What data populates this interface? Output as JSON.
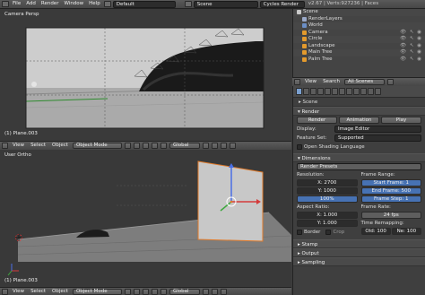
{
  "topbar": {
    "menus": [
      "File",
      "Add",
      "Render",
      "Window",
      "Help"
    ],
    "layout": "Default",
    "scene": "Scene",
    "engine": "Cycles Render",
    "stats": "v2.67 | Verts:927236 | Faces"
  },
  "viewport_top": {
    "label": "Camera Persp",
    "object": "(1) Plane.003",
    "header": {
      "menus": [
        "View",
        "Select",
        "Object"
      ],
      "mode": "Object Mode",
      "orientation": "Global"
    }
  },
  "viewport_bottom": {
    "label": "User Ortho",
    "object": "(1) Plane.003",
    "header": {
      "menus": [
        "View",
        "Select",
        "Object"
      ],
      "mode": "Object Mode",
      "orientation": "Global"
    }
  },
  "outliner": {
    "rows": [
      {
        "label": "Scene",
        "color": "#c9c9c9",
        "indent": 0
      },
      {
        "label": "RenderLayers",
        "color": "#9aa9c8",
        "indent": 1
      },
      {
        "label": "World",
        "color": "#6b8fc7",
        "indent": 1
      },
      {
        "label": "Camera",
        "color": "#e39a2d",
        "indent": 1
      },
      {
        "label": "Circle",
        "color": "#e39a2d",
        "indent": 1
      },
      {
        "label": "Landscape",
        "color": "#e39a2d",
        "indent": 1
      },
      {
        "label": "Main Tree",
        "color": "#e39a2d",
        "indent": 1
      },
      {
        "label": "Palm Tree",
        "color": "#e39a2d",
        "indent": 1
      }
    ],
    "header": {
      "menus": [
        "View",
        "Search"
      ],
      "filter": "All Scenes"
    }
  },
  "properties": {
    "breadcrumb": "Scene",
    "render_panel": {
      "title": "Render",
      "buttons": [
        "Render",
        "Animation",
        "Play"
      ],
      "display_label": "Display:",
      "display_value": "Image Editor",
      "feature_label": "Feature Set:",
      "feature_value": "Supported",
      "osl_label": "Open Shading Language"
    },
    "dimensions_panel": {
      "title": "Dimensions",
      "presets": "Render Presets",
      "resolution_label": "Resolution:",
      "res_x": "X: 2700",
      "res_y": "Y: 1000",
      "res_pct": "100%",
      "frame_range_label": "Frame Range:",
      "start": "Start Frame: 1",
      "end": "End Frame: 500",
      "step": "Frame Step: 1",
      "aspect_label": "Aspect Ratio:",
      "asp_x": "X: 1.000",
      "asp_y": "Y: 1.000",
      "frame_rate_label": "Frame Rate:",
      "fps": "24 fps",
      "remap_label": "Time Remapping:",
      "old": "Old: 100",
      "new": "Ne: 100",
      "border": "Border",
      "crop": "Crop"
    },
    "collapsed": [
      "Stamp",
      "Output",
      "Sampling"
    ]
  },
  "colors": {
    "accent": "#4772b3",
    "object_orange": "#e39a2d"
  }
}
